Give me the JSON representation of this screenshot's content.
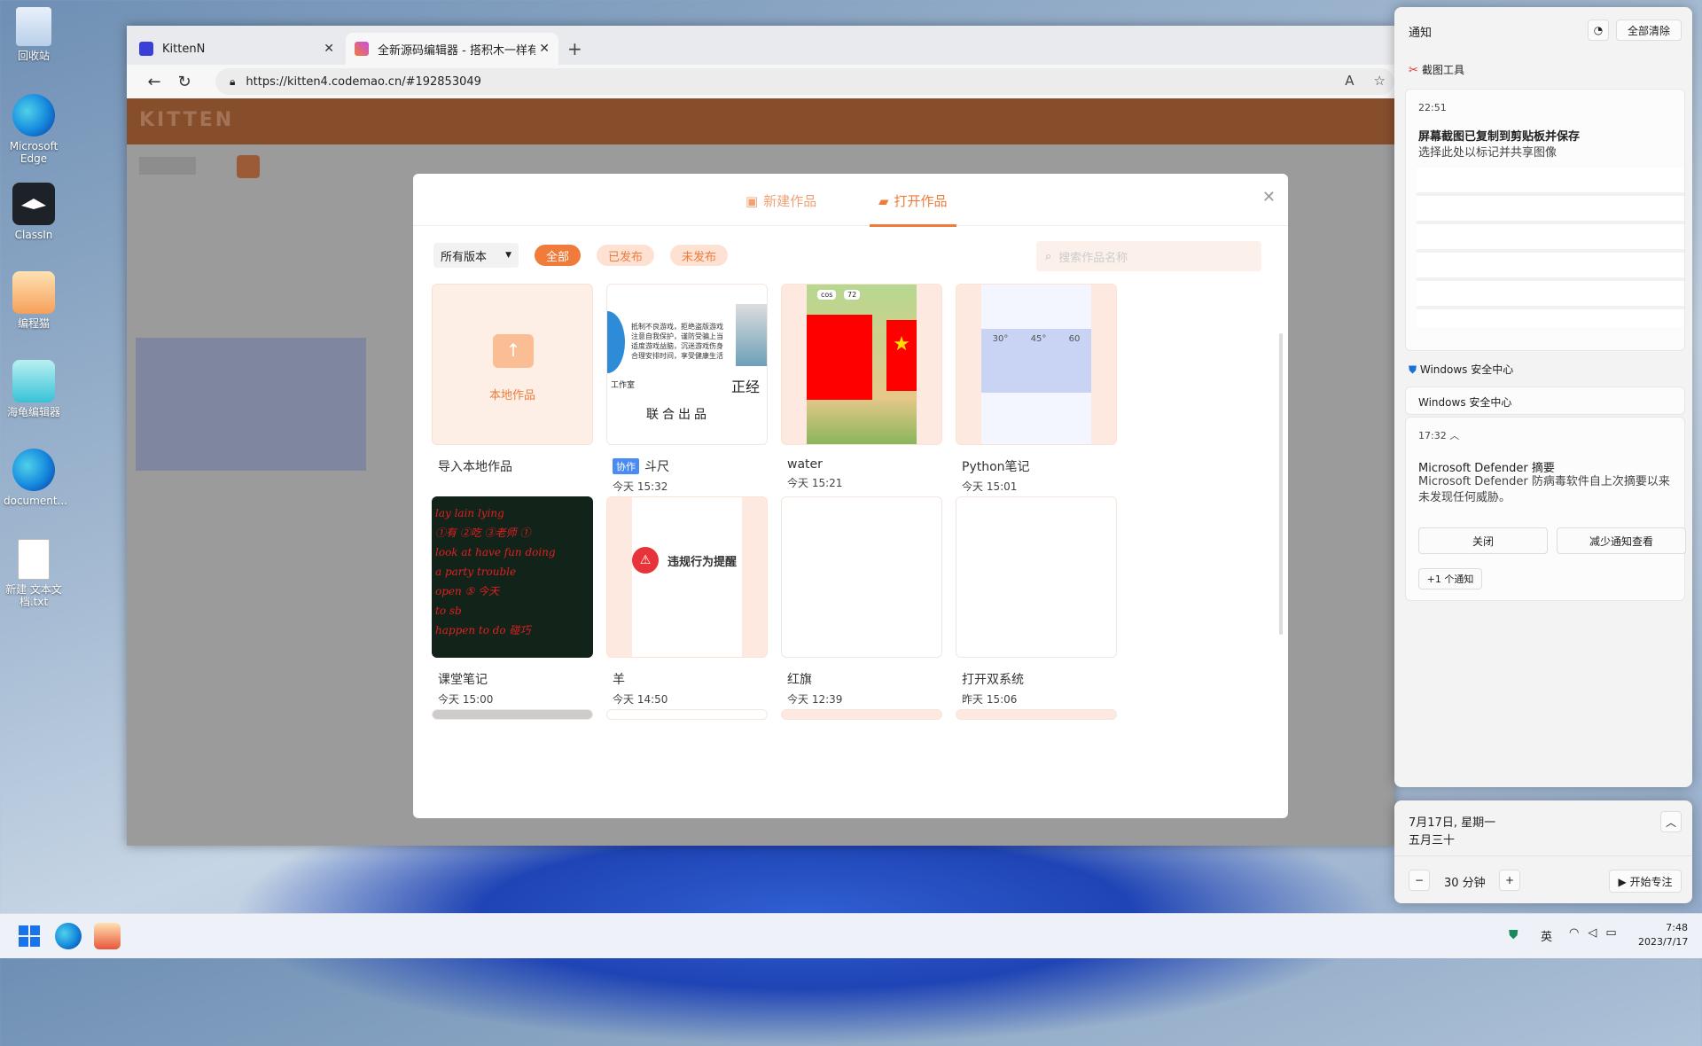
{
  "desktop": {
    "icons": [
      {
        "label": "回收站"
      },
      {
        "label": "Microsoft Edge"
      },
      {
        "label": "ClassIn"
      },
      {
        "label": "编程猫"
      },
      {
        "label": "海龟编辑器"
      },
      {
        "label": "document..."
      },
      {
        "label": "新建 文本文档.txt"
      }
    ]
  },
  "browser": {
    "tabs": [
      {
        "title": "KittenN"
      },
      {
        "title": "全新源码编辑器 - 搭积木一样有趣"
      }
    ],
    "url": "https://kitten4.codemao.cn/#192853049"
  },
  "kitten": {
    "logo": "KITTEN"
  },
  "modal": {
    "tab_new": "新建作品",
    "tab_open": "打开作品",
    "version_select": "所有版本",
    "filters": [
      "全部",
      "已发布",
      "未发布"
    ],
    "search_placeholder": "搜索作品名称",
    "import_label": "本地作品",
    "works": [
      {
        "title": "导入本地作品",
        "time": ""
      },
      {
        "title": "斗尺",
        "time": "今天 15:32",
        "badge": "协作"
      },
      {
        "title": "water",
        "time": "今天 15:21"
      },
      {
        "title": "Python笔记",
        "time": "今天 15:01"
      },
      {
        "title": "课堂笔记",
        "time": "今天 15:00"
      },
      {
        "title": "羊",
        "time": "今天 14:50"
      },
      {
        "title": "红旗",
        "time": "今天 12:39"
      },
      {
        "title": "打开双系统",
        "time": "昨天 15:06"
      }
    ],
    "thumb_text": {
      "doudou_text": "抵制不良游戏，拒绝盗版游戏 注意自我保护，谨防受骗上当 适度游戏益脑，沉迷游戏伤身 合理安排时间，享受健康生活",
      "doudou_studio": "工作室",
      "doudou_zheng": "正经",
      "doudou_lianhe": "联合出品",
      "water_num": "72",
      "water_cos": "cos",
      "python_angles": [
        "30°",
        "45°",
        "60"
      ],
      "sheep_warning": "违规行为提醒",
      "note_lines": [
        "lay lain lying",
        "①有 ②吃 ③老师 ①",
        "look at  have fun doing",
        "a party  trouble",
        "open ⑤ 今天",
        "to sb",
        "happen to do 碰巧"
      ]
    }
  },
  "notifications": {
    "header": "通知",
    "clear_all": "全部清除",
    "snip_app": "截图工具",
    "snip_time": "22:51",
    "snip_title": "屏幕截图已复制到剪贴板并保存",
    "snip_body": "选择此处以标记并共享图像",
    "sec_app": "Windows 安全中心",
    "sec_group": "Windows 安全中心",
    "def_time": "17:32",
    "def_title": "Microsoft Defender 摘要",
    "def_body": "Microsoft Defender 防病毒软件自上次摘要以来未发现任何威胁。",
    "btn_close": "关闭",
    "btn_reduce": "减少通知查看",
    "more": "+1 个通知"
  },
  "calendar": {
    "date": "7月17日, 星期一",
    "lunar": "五月三十",
    "focus_minutes": "30 分钟",
    "focus_btn": "▶ 开始专注"
  },
  "taskbar": {
    "ime": "英",
    "time": "7:48",
    "date": "2023/7/17"
  },
  "colors": {
    "accent": "#f07b3b",
    "accent_light": "#fde2d3"
  }
}
